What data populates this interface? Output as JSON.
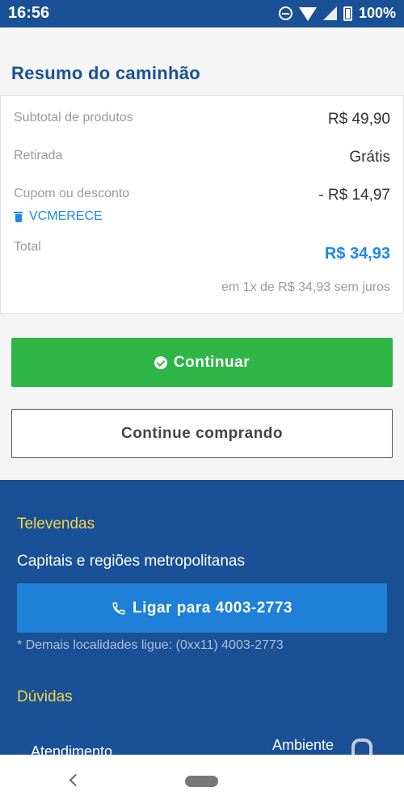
{
  "statusbar": {
    "time": "16:56",
    "battery": "100%"
  },
  "summary": {
    "title": "Resumo do caminhão",
    "rows": {
      "subtotal_label": "Subtotal de produtos",
      "subtotal_value": "R$ 49,90",
      "retirada_label": "Retirada",
      "retirada_value": "Grátis",
      "cupom_label": "Cupom ou desconto",
      "cupom_value": "- R$ 14,97",
      "cupom_code": "VCMERECE",
      "total_label": "Total",
      "total_value": "R$ 34,93",
      "installment": "em 1x de R$ 34,93 sem juros"
    },
    "continue_label": "Continuar",
    "keep_shopping_label": "Continue comprando"
  },
  "footer": {
    "televendas_title": "Televendas",
    "capitais": "Capitais e regiões metropolitanas",
    "call_label": "Ligar para 4003-2773",
    "note": "* Demais localidades ligue: (0xx11) 4003-2773",
    "duvidas_title": "Dúvidas",
    "atendimento": "Atendimento",
    "ambiente": "Ambiente"
  },
  "colors": {
    "brand_blue": "#1a5095",
    "accent_green": "#2eb546",
    "link_blue": "#1e88e5",
    "footer_title_yellow": "#f5d547"
  }
}
